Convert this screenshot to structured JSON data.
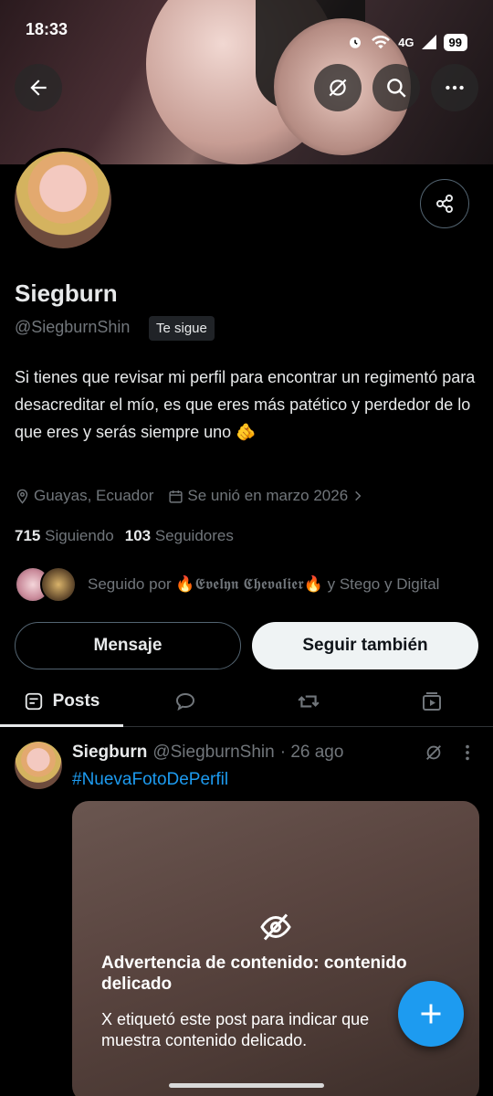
{
  "status_bar": {
    "time": "18:33",
    "network": "4G",
    "battery": "99"
  },
  "profile": {
    "name": "Siegburn",
    "handle": "@SiegburnShin",
    "follows_you": "Te sigue",
    "bio": "Si tienes que revisar mi perfil para encontrar un regimentó para desacreditar el mío, es que eres más patético y perdedor de lo que eres y serás siempre uno 🫵",
    "location": "Guayas, Ecuador",
    "joined": "Se unió en marzo 2026",
    "following_count": "715",
    "following_label": "Siguiendo",
    "followers_count": "103",
    "followers_label": "Seguidores",
    "followed_by": "Seguido por 🔥𝕰𝖛𝖊𝖑𝖞𝖓 𝕮𝖍𝖊𝖛𝖆𝖑𝖎𝖊𝖗🔥 y Stego y Digital"
  },
  "actions": {
    "message": "Mensaje",
    "follow": "Seguir también"
  },
  "tabs": [
    {
      "label": "Posts",
      "icon": "posts-icon"
    },
    {
      "icon": "reply-icon"
    },
    {
      "icon": "repost-icon"
    },
    {
      "icon": "media-icon"
    }
  ],
  "post": {
    "name": "Siegburn",
    "handle": "@SiegburnShin",
    "date": "· 26 ago",
    "hashtag": "#NuevaFotoDePerfil",
    "warning_title": "Advertencia de contenido: contenido delicado",
    "warning_desc": "X etiquetó este post para indicar que muestra contenido delicado."
  },
  "colors": {
    "accent": "#1d9bf0",
    "background": "#000000",
    "secondary_text": "#71767b"
  }
}
